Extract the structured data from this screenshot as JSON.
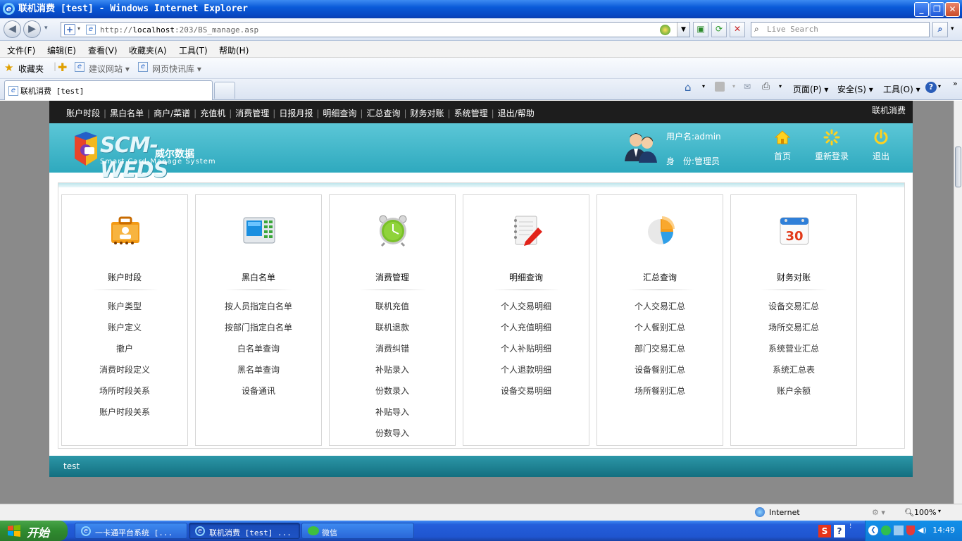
{
  "window": {
    "title": "联机消费 [test] - Windows Internet Explorer"
  },
  "address": {
    "url_prefix": "http://",
    "url_host": "localhost",
    "url_rest": ":203/BS_manage.asp"
  },
  "search": {
    "placeholder": "Live Search"
  },
  "menu": [
    "文件(F)",
    "编辑(E)",
    "查看(V)",
    "收藏夹(A)",
    "工具(T)",
    "帮助(H)"
  ],
  "favorites": {
    "label": "收藏夹",
    "suggested": "建议网站 ▾",
    "slices": "网页快讯库 ▾"
  },
  "tab": {
    "title": "联机消费 [test]"
  },
  "commandbar": {
    "page": "页面(P) ▾",
    "safety": "安全(S) ▾",
    "tools": "工具(O) ▾"
  },
  "topnav": {
    "items": [
      "账户时段",
      "黑白名单",
      "商户/菜谱",
      "充值机",
      "消费管理",
      "日报月报",
      "明细查询",
      "汇总查询",
      "财务对账",
      "系统管理",
      "退出/帮助"
    ],
    "right": "联机消费"
  },
  "logo": {
    "brand": "SCM-WEDS",
    "cn": "威尔数据",
    "en": "Smart Card-Manage System"
  },
  "user": {
    "name_line": "用户名:admin",
    "role_line": "身　份:管理员"
  },
  "header_buttons": [
    "首页",
    "重新登录",
    "退出"
  ],
  "columns": [
    {
      "title": "账户时段",
      "items": [
        "账户类型",
        "账户定义",
        "撤户",
        "消费时段定义",
        "场所时段关系",
        "账户时段关系"
      ]
    },
    {
      "title": "黑白名单",
      "items": [
        "按人员指定白名单",
        "按部门指定白名单",
        "白名单查询",
        "黑名单查询",
        "设备通讯"
      ]
    },
    {
      "title": "消费管理",
      "items": [
        "联机充值",
        "联机退款",
        "消费纠错",
        "补贴录入",
        "份数录入",
        "补贴导入",
        "份数导入"
      ]
    },
    {
      "title": "明细查询",
      "items": [
        "个人交易明细",
        "个人充值明细",
        "个人补贴明细",
        "个人退款明细",
        "设备交易明细"
      ]
    },
    {
      "title": "汇总查询",
      "items": [
        "个人交易汇总",
        "个人餐别汇总",
        "部门交易汇总",
        "设备餐别汇总",
        "场所餐别汇总"
      ]
    },
    {
      "title": "财务对账",
      "items": [
        "设备交易汇总",
        "场所交易汇总",
        "系统营业汇总",
        "系统汇总表",
        "账户余额"
      ]
    }
  ],
  "footer": {
    "text": "test"
  },
  "status": {
    "zone": "Internet",
    "zoom": "100%"
  },
  "taskbar": {
    "start": "开始",
    "tasks": [
      "一卡通平台系统 [...",
      "联机消费 [test] ...",
      "微信"
    ],
    "time": "14:49"
  },
  "colors": {
    "header_teal": "#3fb6c9",
    "nav_dark": "#1d1d1d",
    "footer_teal": "#1f8394"
  }
}
